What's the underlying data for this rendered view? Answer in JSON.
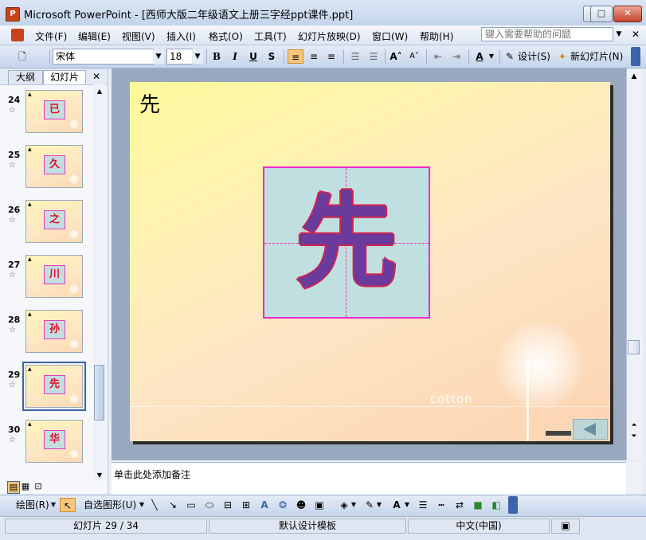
{
  "window": {
    "title": "Microsoft PowerPoint - [西师大版二年级语文上册三字经ppt课件.ppt]",
    "app_icon": "P",
    "minimize": "—",
    "maximize": "□",
    "close": "✕"
  },
  "menu": {
    "items": [
      "文件(F)",
      "编辑(E)",
      "视图(V)",
      "插入(I)",
      "格式(O)",
      "工具(T)",
      "幻灯片放映(D)",
      "窗口(W)",
      "帮助(H)"
    ],
    "help_placeholder": "键入需要帮助的问题",
    "close": "✕"
  },
  "toolbar": {
    "font_name": "宋体",
    "font_size": "18",
    "bold": "B",
    "italic": "I",
    "underline": "U",
    "shadow": "S",
    "design_label": "设计(S)",
    "new_slide_label": "新幻灯片(N)"
  },
  "left_pane": {
    "tabs": [
      "大纲",
      "幻灯片"
    ],
    "close": "✕",
    "thumbnails": [
      {
        "num": "24",
        "char": "已"
      },
      {
        "num": "25",
        "char": "久"
      },
      {
        "num": "26",
        "char": "之"
      },
      {
        "num": "27",
        "char": "川"
      },
      {
        "num": "28",
        "char": "孙"
      },
      {
        "num": "29",
        "char": "先"
      },
      {
        "num": "30",
        "char": "华"
      }
    ],
    "selected_index": 5,
    "star": "☆"
  },
  "slide": {
    "title": "先",
    "character": "先",
    "watermark": "cotton",
    "nav_label": "◀"
  },
  "notes": {
    "placeholder": "单击此处添加备注"
  },
  "drawing_toolbar": {
    "draw_label": "绘图(R)",
    "autoshapes_label": "自选图形(U)"
  },
  "status": {
    "slide_counter": "幻灯片 29 / 34",
    "design_template": "默认设计模板",
    "language": "中文(中国)"
  },
  "colors": {
    "char_box_border": "#ef2ad0",
    "char_fill": "#6a3a9c",
    "char_outline": "#d4234f",
    "thumb_char": "#e0102b"
  }
}
